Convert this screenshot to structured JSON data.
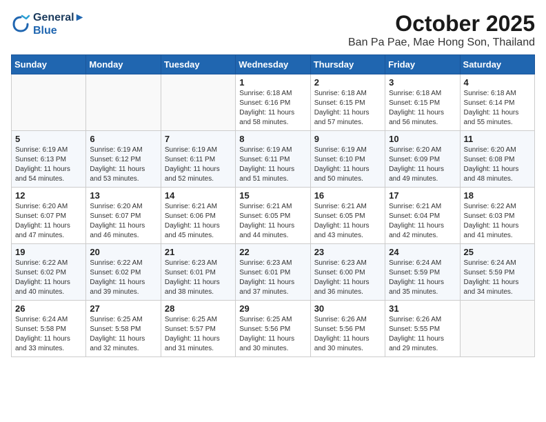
{
  "header": {
    "logo_line1": "General",
    "logo_line2": "Blue",
    "month_title": "October 2025",
    "location": "Ban Pa Pae, Mae Hong Son, Thailand"
  },
  "calendar": {
    "weekdays": [
      "Sunday",
      "Monday",
      "Tuesday",
      "Wednesday",
      "Thursday",
      "Friday",
      "Saturday"
    ],
    "weeks": [
      [
        {
          "day": "",
          "info": ""
        },
        {
          "day": "",
          "info": ""
        },
        {
          "day": "",
          "info": ""
        },
        {
          "day": "1",
          "info": "Sunrise: 6:18 AM\nSunset: 6:16 PM\nDaylight: 11 hours\nand 58 minutes."
        },
        {
          "day": "2",
          "info": "Sunrise: 6:18 AM\nSunset: 6:15 PM\nDaylight: 11 hours\nand 57 minutes."
        },
        {
          "day": "3",
          "info": "Sunrise: 6:18 AM\nSunset: 6:15 PM\nDaylight: 11 hours\nand 56 minutes."
        },
        {
          "day": "4",
          "info": "Sunrise: 6:18 AM\nSunset: 6:14 PM\nDaylight: 11 hours\nand 55 minutes."
        }
      ],
      [
        {
          "day": "5",
          "info": "Sunrise: 6:19 AM\nSunset: 6:13 PM\nDaylight: 11 hours\nand 54 minutes."
        },
        {
          "day": "6",
          "info": "Sunrise: 6:19 AM\nSunset: 6:12 PM\nDaylight: 11 hours\nand 53 minutes."
        },
        {
          "day": "7",
          "info": "Sunrise: 6:19 AM\nSunset: 6:11 PM\nDaylight: 11 hours\nand 52 minutes."
        },
        {
          "day": "8",
          "info": "Sunrise: 6:19 AM\nSunset: 6:11 PM\nDaylight: 11 hours\nand 51 minutes."
        },
        {
          "day": "9",
          "info": "Sunrise: 6:19 AM\nSunset: 6:10 PM\nDaylight: 11 hours\nand 50 minutes."
        },
        {
          "day": "10",
          "info": "Sunrise: 6:20 AM\nSunset: 6:09 PM\nDaylight: 11 hours\nand 49 minutes."
        },
        {
          "day": "11",
          "info": "Sunrise: 6:20 AM\nSunset: 6:08 PM\nDaylight: 11 hours\nand 48 minutes."
        }
      ],
      [
        {
          "day": "12",
          "info": "Sunrise: 6:20 AM\nSunset: 6:07 PM\nDaylight: 11 hours\nand 47 minutes."
        },
        {
          "day": "13",
          "info": "Sunrise: 6:20 AM\nSunset: 6:07 PM\nDaylight: 11 hours\nand 46 minutes."
        },
        {
          "day": "14",
          "info": "Sunrise: 6:21 AM\nSunset: 6:06 PM\nDaylight: 11 hours\nand 45 minutes."
        },
        {
          "day": "15",
          "info": "Sunrise: 6:21 AM\nSunset: 6:05 PM\nDaylight: 11 hours\nand 44 minutes."
        },
        {
          "day": "16",
          "info": "Sunrise: 6:21 AM\nSunset: 6:05 PM\nDaylight: 11 hours\nand 43 minutes."
        },
        {
          "day": "17",
          "info": "Sunrise: 6:21 AM\nSunset: 6:04 PM\nDaylight: 11 hours\nand 42 minutes."
        },
        {
          "day": "18",
          "info": "Sunrise: 6:22 AM\nSunset: 6:03 PM\nDaylight: 11 hours\nand 41 minutes."
        }
      ],
      [
        {
          "day": "19",
          "info": "Sunrise: 6:22 AM\nSunset: 6:02 PM\nDaylight: 11 hours\nand 40 minutes."
        },
        {
          "day": "20",
          "info": "Sunrise: 6:22 AM\nSunset: 6:02 PM\nDaylight: 11 hours\nand 39 minutes."
        },
        {
          "day": "21",
          "info": "Sunrise: 6:23 AM\nSunset: 6:01 PM\nDaylight: 11 hours\nand 38 minutes."
        },
        {
          "day": "22",
          "info": "Sunrise: 6:23 AM\nSunset: 6:01 PM\nDaylight: 11 hours\nand 37 minutes."
        },
        {
          "day": "23",
          "info": "Sunrise: 6:23 AM\nSunset: 6:00 PM\nDaylight: 11 hours\nand 36 minutes."
        },
        {
          "day": "24",
          "info": "Sunrise: 6:24 AM\nSunset: 5:59 PM\nDaylight: 11 hours\nand 35 minutes."
        },
        {
          "day": "25",
          "info": "Sunrise: 6:24 AM\nSunset: 5:59 PM\nDaylight: 11 hours\nand 34 minutes."
        }
      ],
      [
        {
          "day": "26",
          "info": "Sunrise: 6:24 AM\nSunset: 5:58 PM\nDaylight: 11 hours\nand 33 minutes."
        },
        {
          "day": "27",
          "info": "Sunrise: 6:25 AM\nSunset: 5:58 PM\nDaylight: 11 hours\nand 32 minutes."
        },
        {
          "day": "28",
          "info": "Sunrise: 6:25 AM\nSunset: 5:57 PM\nDaylight: 11 hours\nand 31 minutes."
        },
        {
          "day": "29",
          "info": "Sunrise: 6:25 AM\nSunset: 5:56 PM\nDaylight: 11 hours\nand 30 minutes."
        },
        {
          "day": "30",
          "info": "Sunrise: 6:26 AM\nSunset: 5:56 PM\nDaylight: 11 hours\nand 30 minutes."
        },
        {
          "day": "31",
          "info": "Sunrise: 6:26 AM\nSunset: 5:55 PM\nDaylight: 11 hours\nand 29 minutes."
        },
        {
          "day": "",
          "info": ""
        }
      ]
    ]
  }
}
